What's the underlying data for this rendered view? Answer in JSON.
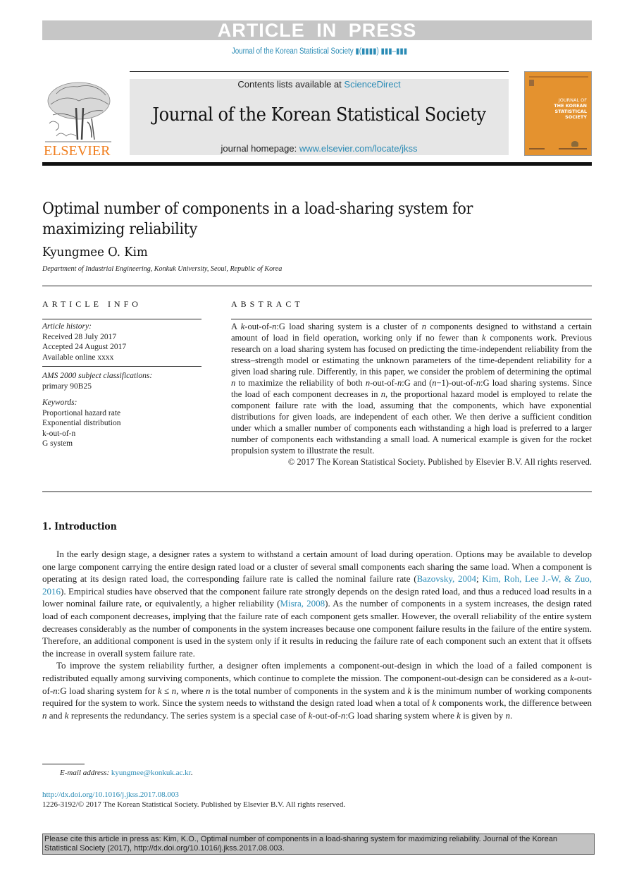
{
  "banner": {
    "text": "ARTICLE IN PRESS"
  },
  "journal_ref": "Journal of the Korean Statistical Society ▮(▮▮▮▮) ▮▮▮–▮▮▮",
  "header": {
    "publisher_logo_text": "ELSEVIER",
    "contents_prefix": "Contents lists available at ",
    "contents_link": "ScienceDirect",
    "journal_title": "Journal of the Korean Statistical Society",
    "homepage_prefix": "journal homepage: ",
    "homepage_link": "www.elsevier.com/locate/jkss",
    "cover": {
      "line1": "JOURNAL OF",
      "line2": "THE KOREAN",
      "line3": "STATISTICAL",
      "line4": "SOCIETY",
      "color": "#e4922f"
    }
  },
  "article": {
    "title_line1": "Optimal number of components in a load-sharing system for",
    "title_line2": "maximizing reliability",
    "author": "Kyungmee O. Kim",
    "affiliation": "Department of Industrial Engineering, Konkuk University, Seoul, Republic of Korea"
  },
  "article_info": {
    "heading": "ARTICLE INFO",
    "history_label": "Article history:",
    "received": "Received 28 July 2017",
    "accepted": "Accepted 24 August 2017",
    "online": "Available online xxxx",
    "ams_label": "AMS 2000 subject classifications:",
    "ams_value": "primary 90B25",
    "keywords_label": "Keywords:",
    "keywords": [
      "Proportional hazard rate",
      "Exponential distribution",
      "k-out-of-n",
      "G system"
    ]
  },
  "abstract": {
    "heading": "ABSTRACT",
    "s1a": "A ",
    "s1k": "k",
    "s1b": "-out-of-",
    "s1n": "n",
    "s1c": ":G load sharing system is a cluster of ",
    "s1n2": "n",
    "s1d": " components designed to withstand a certain amount of load in field operation, working only if no fewer than ",
    "s1k2": "k",
    "s1e": " components work. Previous research on a load sharing system has focused on predicting the time-independent reliability from the stress–strength model or estimating the unknown parameters of the time-dependent reliability for a given load sharing rule. Differently, in this paper, we consider the problem of determining the optimal ",
    "s2n": "n",
    "s2a": " to maximize the reliability of both ",
    "s2n2": "n",
    "s2b": "-out-of-",
    "s2n3": "n",
    "s2c": ":G and (",
    "s2n4": "n",
    "s2d": "−1)-out-of-",
    "s2n5": "n",
    "s2e": ":G load sharing systems. Since the load of each component decreases in ",
    "s2n6": "n",
    "s2f": ", the proportional hazard model is employed to relate the component failure rate with the load, assuming that the components, which have exponential distributions for given loads, are independent of each other. We then derive a sufficient condition under which a smaller number of components each withstanding a high load is preferred to a larger number of components each withstanding a small load. A numerical example is given for the rocket propulsion system to illustrate the result.",
    "copyright": "© 2017 The Korean Statistical Society. Published by Elsevier B.V. All rights reserved."
  },
  "intro": {
    "heading": "1.  Introduction",
    "p1a": "In the early design stage, a designer rates a system to withstand a certain amount of load during operation. Options may be available to develop one large component carrying the entire design rated load or a cluster of several small components each sharing the same load. When a component is operating at its design rated load, the corresponding failure rate is called the nominal failure rate (",
    "ref1": "Bazovsky, 2004",
    "p1b": "; ",
    "ref2": "Kim, Roh, Lee J.-W, & Zuo, 2016",
    "p1c": "). Empirical studies have observed that the component failure rate strongly depends on the design rated load, and thus a reduced load results in a lower nominal failure rate, or equivalently, a higher reliability  (",
    "ref3": "Misra, 2008",
    "p1d": "). As the number of components in a system increases, the design rated load of each component decreases, implying that the failure rate of each component gets smaller. However, the overall reliability of the entire system decreases considerably as the number of components in the system increases because one component failure results in the failure of the entire system. Therefore, an additional component is used in the system only if it results in reducing the failure rate of each component such an extent that it offsets the increase in overall system failure rate.",
    "p2a": "To improve the system reliability further, a designer often implements a component-out-design in which the load of a failed component is redistributed equally among surviving components, which continue to complete the mission. The component-out-design can be considered as a ",
    "p2k": "k",
    "p2b": "-out-of-",
    "p2n": "n",
    "p2c": ":G load sharing system for ",
    "p2k2": "k",
    "p2le": " ≤ ",
    "p2n2": "n",
    "p2d": ", where ",
    "p2n3": "n",
    "p2e": " is the total number of components in the system and ",
    "p2k3": "k",
    "p2f": " is the minimum number of working components required for the system to work. Since the system needs to withstand the design rated load when a total of ",
    "p2k4": "k",
    "p2g": " components work, the difference between ",
    "p2n4": "n",
    "p2h": " and ",
    "p2k5": "k",
    "p2i": " represents the redundancy. The series system is a special case of ",
    "p2k6": "k",
    "p2j": "-out-of-",
    "p2n5": "n",
    "p2l": ":G load sharing system where ",
    "p2k7": "k",
    "p2m": " is given by ",
    "p2n6": "n",
    "p2o": "."
  },
  "footnote": {
    "email_label": "E-mail address: ",
    "email": "kyungmee@konkuk.ac.kr",
    "email_end": "."
  },
  "doi": "http://dx.doi.org/10.1016/j.jkss.2017.08.003",
  "issn": "1226-3192/© 2017 The Korean Statistical Society. Published by Elsevier B.V. All rights reserved.",
  "citation": "Please cite this article in press as: Kim, K.O., Optimal number of components in a load-sharing system for maximizing reliability. Journal of the Korean Statistical Society (2017), http://dx.doi.org/10.1016/j.jkss.2017.08.003."
}
